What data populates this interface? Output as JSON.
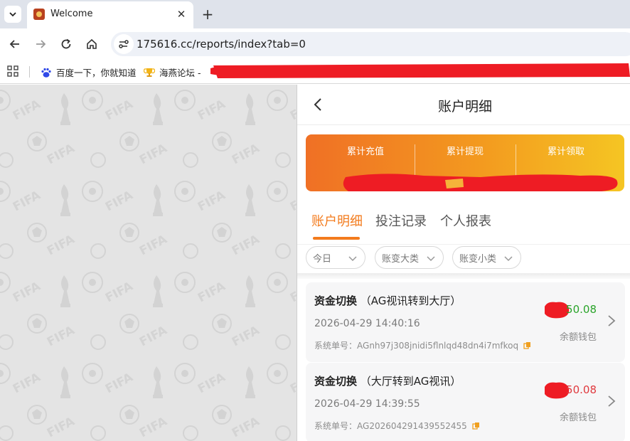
{
  "browser": {
    "tab_title": "Welcome",
    "url": "175616.cc/reports/index?tab=0",
    "bookmarks": [
      {
        "label": "百度一下，你就知道",
        "icon": "baidu-paw-icon"
      },
      {
        "label": "海燕论坛 -",
        "icon": "trophy-icon"
      }
    ]
  },
  "header": {
    "title": "账户明细"
  },
  "summary": {
    "stats": [
      {
        "label": "累计充值"
      },
      {
        "label": "累计提现"
      },
      {
        "label": "累计领取"
      }
    ]
  },
  "tabs": [
    {
      "label": "账户明细",
      "active": true
    },
    {
      "label": "投注记录",
      "active": false
    },
    {
      "label": "个人报表",
      "active": false
    }
  ],
  "filters": [
    {
      "label": "今日"
    },
    {
      "label": "账变大类"
    },
    {
      "label": "账变小类"
    }
  ],
  "records": [
    {
      "type": "资金切换",
      "detail": "（AG视讯转到大厅）",
      "time": "2026-04-29 14:40:16",
      "order_label": "系统单号：",
      "order_no": "AGnh97j308jnidi5flnlqd48dn4i7mfkoq",
      "amount": "50.08",
      "amount_color": "#2aa42a",
      "wallet": "余额钱包"
    },
    {
      "type": "资金切换",
      "detail": "（大厅转到AG视讯）",
      "time": "2026-04-29 14:39:55",
      "order_label": "系统单号：",
      "order_no": "AG202604291439552455",
      "amount": "50.08",
      "amount_color": "#e0393e",
      "wallet": "余额钱包"
    }
  ],
  "colors": {
    "accent": "#f37b1d",
    "redaction": "#ee1c24"
  }
}
